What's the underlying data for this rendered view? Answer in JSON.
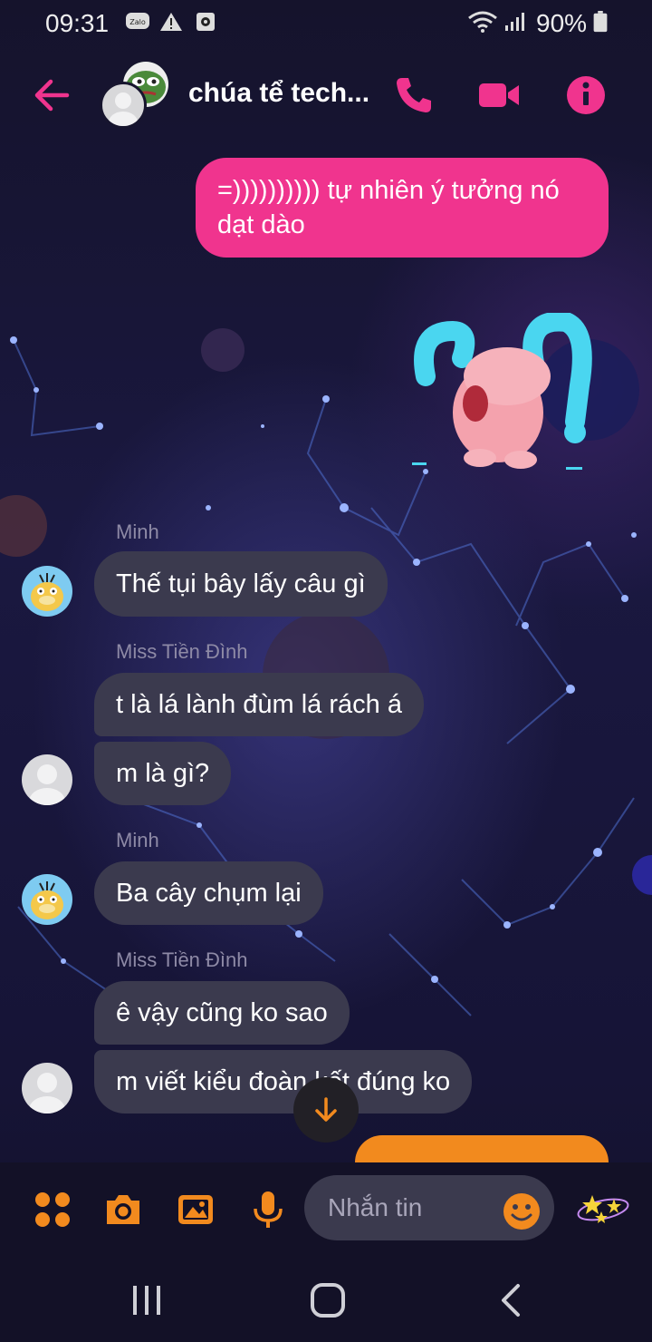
{
  "status_bar": {
    "time": "09:31",
    "battery": "90%",
    "icons": [
      "zalo-icon",
      "warning-icon",
      "screen-record-icon",
      "wifi-icon",
      "signal-icon",
      "battery-icon"
    ]
  },
  "header": {
    "title": "chúa tể tech...",
    "icons": [
      "back-arrow-icon",
      "phone-icon",
      "video-camera-icon",
      "info-icon"
    ]
  },
  "messages": [
    {
      "id": "m1",
      "direction": "out",
      "text": "=)))))))))) tự nhiên ý tưởng nó dạt dào"
    },
    {
      "id": "m2",
      "direction": "out",
      "type": "sticker",
      "icon": "crying-pig-sticker"
    },
    {
      "id": "m3",
      "direction": "in",
      "sender": "Minh",
      "text": "Thế tụi bây lấy câu gì"
    },
    {
      "id": "m4",
      "direction": "in",
      "sender": "Miss Tiền Đình",
      "text": "t là lá lành đùm lá rách á"
    },
    {
      "id": "m5",
      "direction": "in",
      "text": "m là gì?"
    },
    {
      "id": "m6",
      "direction": "in",
      "sender": "Minh",
      "text": "Ba cây chụm lại"
    },
    {
      "id": "m7",
      "direction": "in",
      "sender": "Miss Tiền Đình",
      "text": "ê vậy cũng ko sao"
    },
    {
      "id": "m8",
      "direction": "in",
      "text": "m viết kiểu đoàn kết đúng ko"
    }
  ],
  "composer": {
    "placeholder": "Nhắn tin",
    "icons": [
      "apps-icon",
      "camera-icon",
      "gallery-icon",
      "microphone-icon",
      "emoji-icon",
      "stars-sticker-icon"
    ]
  },
  "colors": {
    "accent_pink": "#f0348e",
    "accent_orange": "#f28a1e",
    "incoming_bubble": "#3b3a4e",
    "background": "#14122a"
  },
  "nav_icons": [
    "recents-icon",
    "home-icon",
    "back-icon"
  ]
}
